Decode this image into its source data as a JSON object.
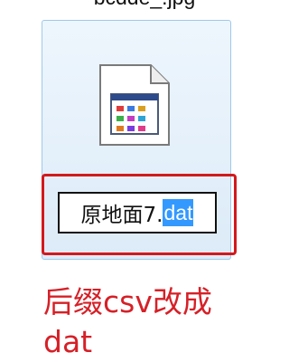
{
  "previous_file": {
    "name": "bcdde_.jpg"
  },
  "file": {
    "icon": "document-icon",
    "rename": {
      "base": "原地面7.",
      "extension": "dat"
    }
  },
  "annotation": {
    "color": "#d62027",
    "text_line1": "后缀csv改成",
    "text_line2": "dat"
  }
}
